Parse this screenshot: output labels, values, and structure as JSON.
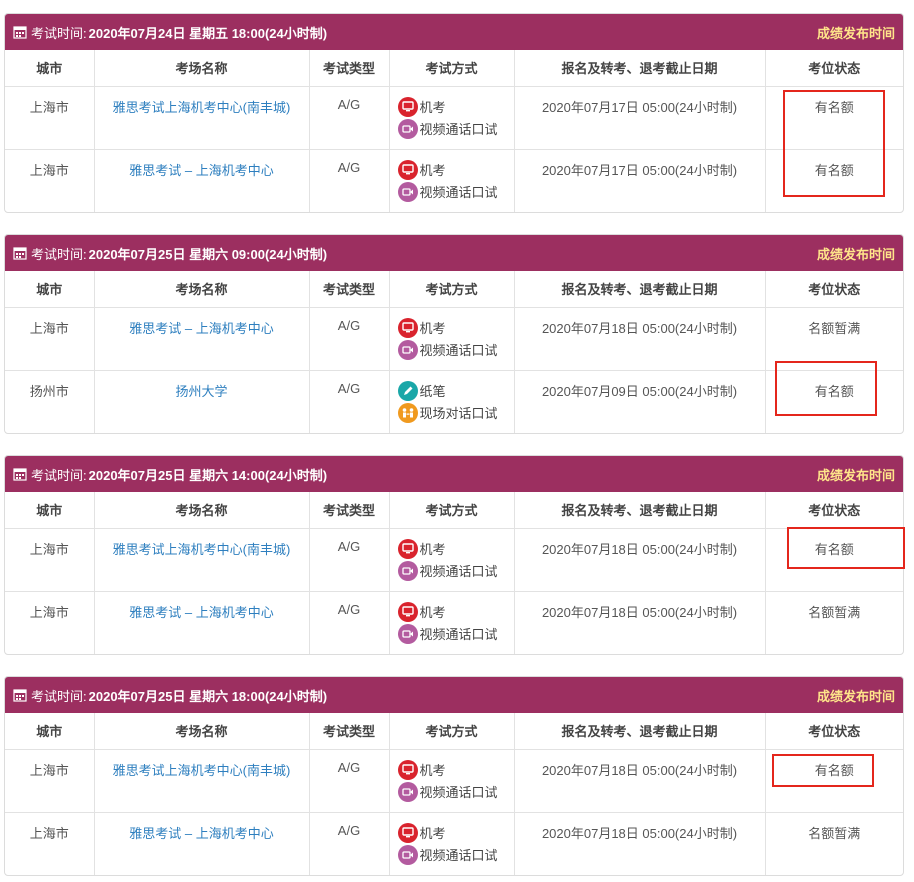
{
  "columns": [
    "城市",
    "考场名称",
    "考试类型",
    "考试方式",
    "报名及转考、退考截止日期",
    "考位状态"
  ],
  "head_label": "考试时间:",
  "result_link": "成绩发布时间",
  "sessions": [
    {
      "time": "2020年07月24日 星期五 18:00(24小时制)",
      "rows": [
        {
          "city": "上海市",
          "venue": "雅思考试上海机考中心(南丰城)",
          "type": "A/G",
          "mode1": "机考",
          "mode2": "视频通话口试",
          "deadline": "2020年07月17日 05:00(24小时制)",
          "status": "有名额"
        },
        {
          "city": "上海市",
          "venue": "雅思考试 – 上海机考中心",
          "type": "A/G",
          "mode1": "机考",
          "mode2": "视频通话口试",
          "deadline": "2020年07月17日 05:00(24小时制)",
          "status": "有名额"
        }
      ]
    },
    {
      "time": "2020年07月25日 星期六 09:00(24小时制)",
      "rows": [
        {
          "city": "上海市",
          "venue": "雅思考试 – 上海机考中心",
          "type": "A/G",
          "mode1": "机考",
          "mode2": "视频通话口试",
          "deadline": "2020年07月18日 05:00(24小时制)",
          "status": "名额暂满"
        },
        {
          "city": "扬州市",
          "venue": "扬州大学",
          "type": "A/G",
          "mode1": "纸笔",
          "mode2": "现场对话口试",
          "deadline": "2020年07月09日 05:00(24小时制)",
          "status": "有名额"
        }
      ]
    },
    {
      "time": "2020年07月25日 星期六 14:00(24小时制)",
      "rows": [
        {
          "city": "上海市",
          "venue": "雅思考试上海机考中心(南丰城)",
          "type": "A/G",
          "mode1": "机考",
          "mode2": "视频通话口试",
          "deadline": "2020年07月18日 05:00(24小时制)",
          "status": "有名额"
        },
        {
          "city": "上海市",
          "venue": "雅思考试 – 上海机考中心",
          "type": "A/G",
          "mode1": "机考",
          "mode2": "视频通话口试",
          "deadline": "2020年07月18日 05:00(24小时制)",
          "status": "名额暂满"
        }
      ]
    },
    {
      "time": "2020年07月25日 星期六 18:00(24小时制)",
      "rows": [
        {
          "city": "上海市",
          "venue": "雅思考试上海机考中心(南丰城)",
          "type": "A/G",
          "mode1": "机考",
          "mode2": "视频通话口试",
          "deadline": "2020年07月18日 05:00(24小时制)",
          "status": "有名额"
        },
        {
          "city": "上海市",
          "venue": "雅思考试 – 上海机考中心",
          "type": "A/G",
          "mode1": "机考",
          "mode2": "视频通话口试",
          "deadline": "2020年07月18日 05:00(24小时制)",
          "status": "名额暂满"
        }
      ]
    }
  ],
  "icons": {
    "calendar": "calendar-icon",
    "computer": "computer-exam-icon",
    "video": "video-call-icon",
    "pen": "paper-pen-icon",
    "face": "face-to-face-icon"
  },
  "colors": {
    "header_bg": "#9c2f60",
    "result_link": "#ffe58a",
    "venue_link": "#2e7fbf",
    "highlight_box": "#e4261c"
  }
}
